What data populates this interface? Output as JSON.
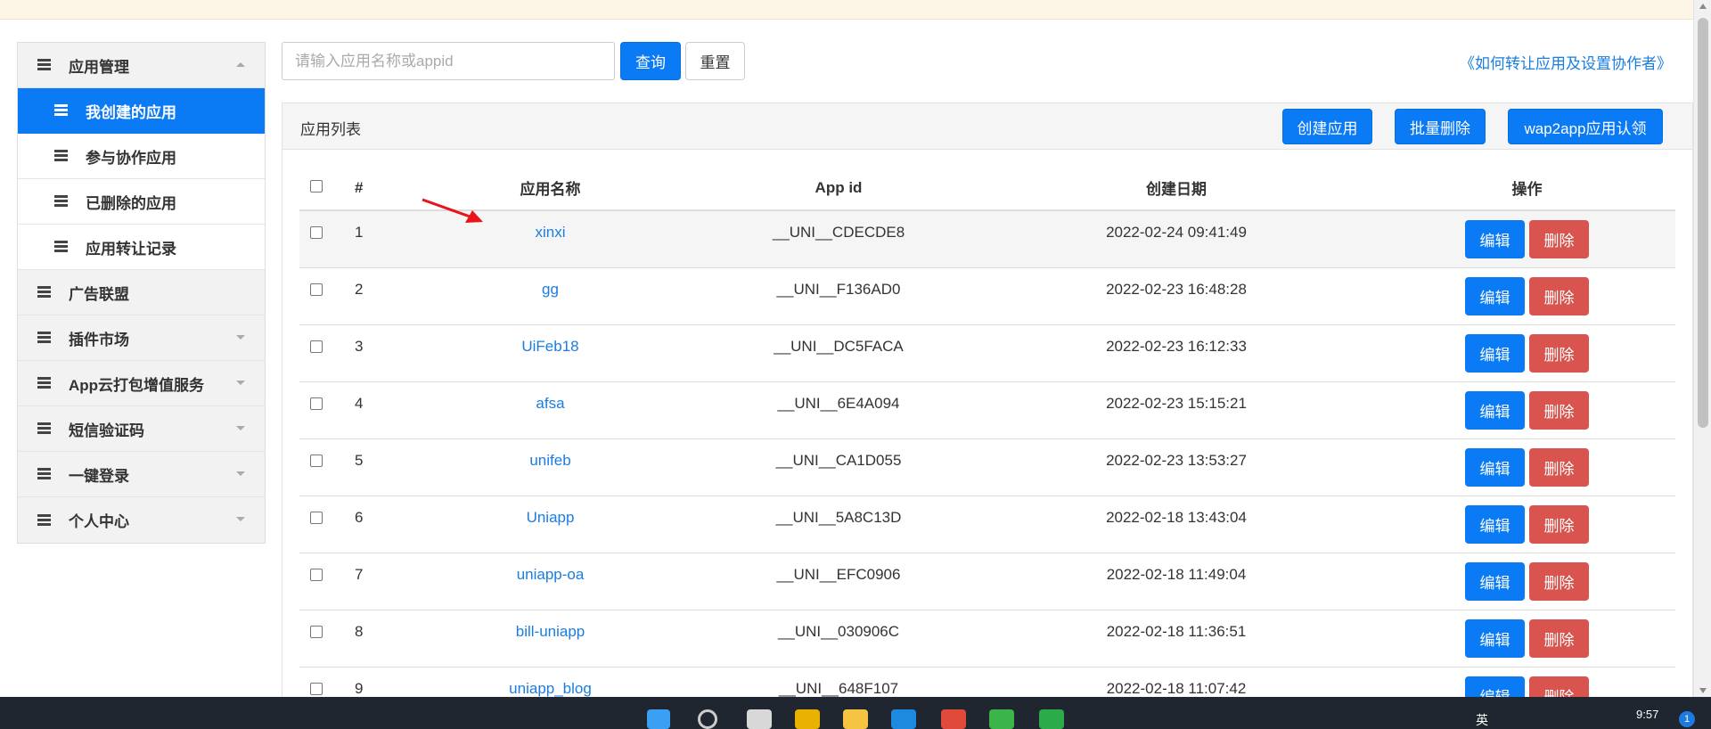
{
  "sidebar": {
    "items": [
      {
        "label": "应用管理",
        "type": "group",
        "caret": "up"
      },
      {
        "label": "我创建的应用",
        "type": "sub",
        "active": true
      },
      {
        "label": "参与协作应用",
        "type": "sub"
      },
      {
        "label": "已删除的应用",
        "type": "sub"
      },
      {
        "label": "应用转让记录",
        "type": "sub"
      },
      {
        "label": "广告联盟",
        "type": "top"
      },
      {
        "label": "插件市场",
        "type": "top",
        "caret": "down"
      },
      {
        "label": "App云打包增值服务",
        "type": "top",
        "caret": "down"
      },
      {
        "label": "短信验证码",
        "type": "top",
        "caret": "down"
      },
      {
        "label": "一键登录",
        "type": "top",
        "caret": "down"
      },
      {
        "label": "个人中心",
        "type": "top",
        "caret": "down"
      }
    ]
  },
  "search": {
    "placeholder": "请输入应用名称或appid",
    "value": "",
    "search_label": "查询",
    "reset_label": "重置"
  },
  "help_link": "《如何转让应用及设置协作者》",
  "panel": {
    "title": "应用列表",
    "create_label": "创建应用",
    "batch_delete_label": "批量删除",
    "wap2app_label": "wap2app应用认领"
  },
  "table": {
    "headers": {
      "num": "#",
      "name": "应用名称",
      "appid": "App id",
      "date": "创建日期",
      "ops": "操作"
    },
    "edit_label": "编辑",
    "delete_label": "删除",
    "rows": [
      {
        "num": "1",
        "name": "xinxi",
        "appid": "__UNI__CDECDE8",
        "date": "2022-02-24 09:41:49"
      },
      {
        "num": "2",
        "name": "gg",
        "appid": "__UNI__F136AD0",
        "date": "2022-02-23 16:48:28"
      },
      {
        "num": "3",
        "name": "UiFeb18",
        "appid": "__UNI__DC5FACA",
        "date": "2022-02-23 16:12:33"
      },
      {
        "num": "4",
        "name": "afsa",
        "appid": "__UNI__6E4A094",
        "date": "2022-02-23 15:15:21"
      },
      {
        "num": "5",
        "name": "unifeb",
        "appid": "__UNI__CA1D055",
        "date": "2022-02-23 13:53:27"
      },
      {
        "num": "6",
        "name": "Uniapp",
        "appid": "__UNI__5A8C13D",
        "date": "2022-02-18 13:43:04"
      },
      {
        "num": "7",
        "name": "uniapp-oa",
        "appid": "__UNI__EFC0906",
        "date": "2022-02-18 11:49:04"
      },
      {
        "num": "8",
        "name": "bill-uniapp",
        "appid": "__UNI__030906C",
        "date": "2022-02-18 11:36:51"
      },
      {
        "num": "9",
        "name": "uniapp_blog",
        "appid": "__UNI__648F107",
        "date": "2022-02-18 11:07:42"
      }
    ]
  },
  "taskbar": {
    "lang": "英",
    "time": "9:57",
    "notification_count": "1"
  },
  "colors": {
    "primary": "#0b7af5",
    "danger": "#d9534f",
    "link": "#1a7de0",
    "arrow": "#e8141a"
  }
}
